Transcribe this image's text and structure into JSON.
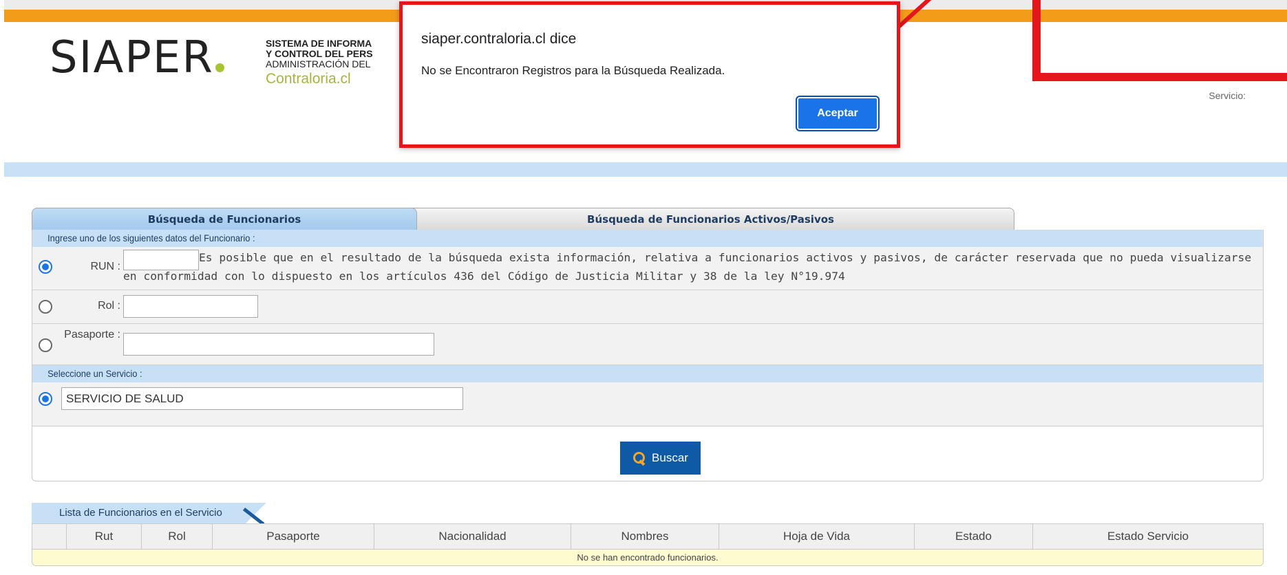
{
  "header": {
    "logo": "SIAPER",
    "subtitle_line1": "SISTEMA DE INFORMA",
    "subtitle_line2": "Y CONTROL DEL PERS",
    "subtitle_line3": "ADMINISTRACIÓN DEL",
    "site": "Contraloria.cl",
    "servicio_label": "Servicio:"
  },
  "dialog": {
    "title": "siaper.contraloria.cl dice",
    "message": "No se Encontraron Registros para la Búsqueda Realizada.",
    "ok_label": "Aceptar"
  },
  "tabs": [
    {
      "label": "Búsqueda de Funcionarios"
    },
    {
      "label": "Búsqueda de Funcionarios Activos/Pasivos"
    }
  ],
  "form": {
    "section1": "Ingrese uno de los siguientes datos del Funcionario :",
    "run_label": "RUN :",
    "run_value": "",
    "note": "Es posible que en el resultado de la búsqueda exista información, relativa a funcionarios activos y pasivos, de carácter reservada que no pueda visualizarse en conformidad con lo dispuesto en los artículos 436 del Código de Justicia Militar y 38 de la ley N°19.974",
    "rol_label": "Rol :",
    "rol_value": "",
    "pasaporte_label": "Pasaporte :",
    "pasaporte_value": "",
    "section2": "Seleccione un Servicio :",
    "servicio_value": "SERVICIO DE SALUD",
    "buscar_label": "Buscar",
    "selected_id_option": "RUN",
    "servicio_selected": true
  },
  "list": {
    "tab_label": "Lista de Funcionarios en el Servicio",
    "columns": [
      "",
      "Rut",
      "Rol",
      "Pasaporte",
      "Nacionalidad",
      "Nombres",
      "Hoja de Vida",
      "Estado",
      "Estado Servicio"
    ],
    "empty_message": "No se han encontrado funcionarios."
  },
  "colors": {
    "accent_orange": "#f39c1a",
    "header_blue": "#c8e0f6",
    "button_blue": "#0e5aa7",
    "dialog_button": "#1a73e8",
    "highlight_red": "#e3161b"
  }
}
